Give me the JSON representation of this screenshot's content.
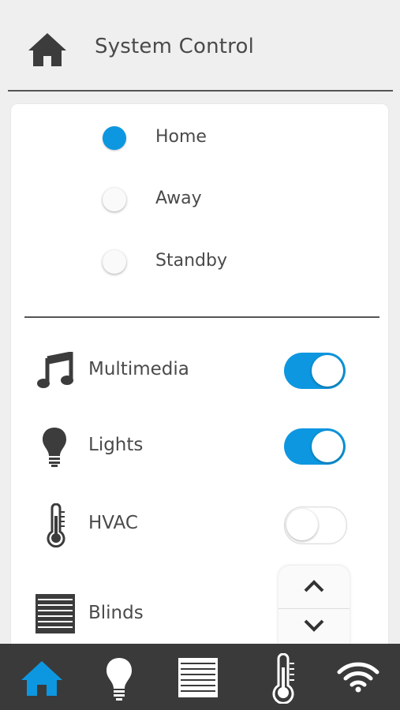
{
  "header": {
    "title": "System Control",
    "icon": "home-icon"
  },
  "modes": [
    {
      "label": "Home",
      "selected": true
    },
    {
      "label": "Away",
      "selected": false
    },
    {
      "label": "Standby",
      "selected": false
    }
  ],
  "systems": [
    {
      "label": "Multimedia",
      "icon": "music-note-icon",
      "on": true
    },
    {
      "label": "Lights",
      "icon": "light-bulb-icon",
      "on": true
    },
    {
      "label": "HVAC",
      "icon": "thermometer-icon",
      "on": false
    },
    {
      "label": "Blinds",
      "icon": "blinds-icon"
    }
  ],
  "stepper": {
    "up_icon": "chevron-up-icon",
    "down_icon": "chevron-down-icon"
  },
  "bottom_nav": [
    {
      "icon": "home-icon",
      "active": true
    },
    {
      "icon": "light-bulb-icon",
      "active": false
    },
    {
      "icon": "blinds-icon",
      "active": false
    },
    {
      "icon": "thermometer-icon",
      "active": false
    },
    {
      "icon": "wifi-icon",
      "active": false
    }
  ],
  "colors": {
    "accent": "#0d97e0",
    "text": "#4a4a4a",
    "bar": "#3a3a3a",
    "background": "#efefef"
  }
}
